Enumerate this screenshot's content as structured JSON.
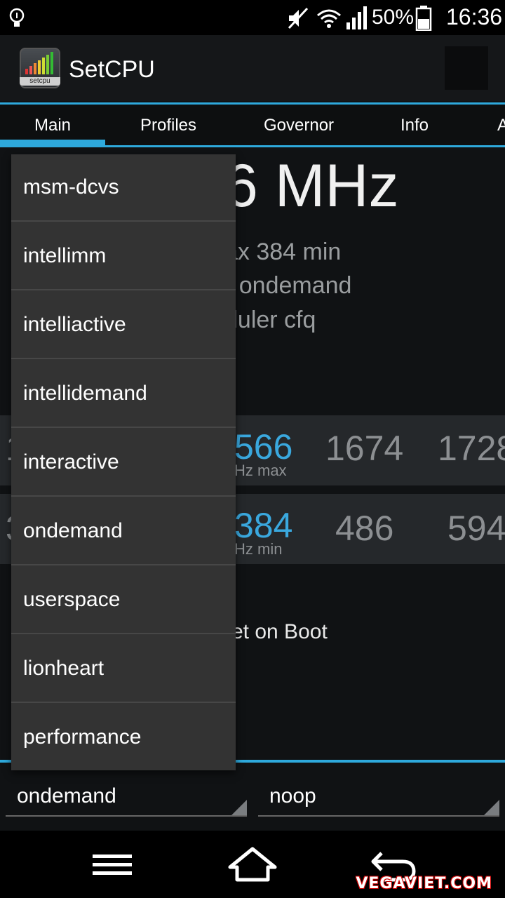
{
  "status_bar": {
    "battery_percent": "50%",
    "time": "16:36",
    "icons": [
      "lightbulb-icon",
      "mute-icon",
      "wifi-icon",
      "signal-icon",
      "battery-icon"
    ]
  },
  "app": {
    "title": "SetCPU",
    "icon_label": "setcpu"
  },
  "tabs": [
    {
      "label": "Main",
      "active": true
    },
    {
      "label": "Profiles",
      "active": false
    },
    {
      "label": "Governor",
      "active": false
    },
    {
      "label": "Info",
      "active": false
    },
    {
      "label": "A",
      "active": false
    }
  ],
  "main": {
    "current_freq": "6 MHz",
    "line_maxmin": "ax 384 min",
    "line_governor": "r ondemand",
    "line_scheduler": "duler cfq",
    "max_picker": {
      "values": [
        "1",
        "566",
        "1674",
        "1728"
      ],
      "sub": "Hz max"
    },
    "min_picker": {
      "values": [
        "3",
        "384",
        "486",
        "594"
      ],
      "sub": "Hz min"
    },
    "set_on_boot": "et on Boot"
  },
  "governor_spinner": {
    "value": "ondemand"
  },
  "scheduler_spinner": {
    "value": "noop"
  },
  "dropdown": {
    "items": [
      "msm-dcvs",
      "intellimm",
      "intelliactive",
      "intellidemand",
      "interactive",
      "ondemand",
      "userspace",
      "lionheart",
      "performance"
    ]
  },
  "watermark": "VEGAVIET.COM",
  "colors": {
    "accent": "#2ea9dc"
  }
}
